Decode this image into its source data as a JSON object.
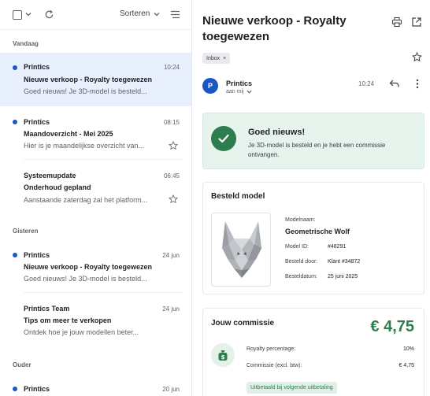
{
  "toolbar": {
    "sort_label": "Sorteren",
    "icons": [
      "select-all-checkbox",
      "chevron-down-icon",
      "refresh-icon",
      "filter-lines-icon"
    ]
  },
  "groups": {
    "today": "Vandaag",
    "yesterday": "Gisteren",
    "older": "Ouder"
  },
  "mail_list": [
    {
      "sender": "Printics",
      "time": "10:24",
      "subject": "Nieuwe verkoop - Royalty toegewezen",
      "snippet": "Goed nieuws! Je 3D-model is besteld...",
      "unread": true,
      "selected": true,
      "star": false
    },
    {
      "sender": "Printics",
      "time": "08:15",
      "subject": "Maandoverzicht - Mei 2025",
      "snippet": "Hier is je maandelijkse overzicht van...",
      "unread": true,
      "selected": false,
      "star": true
    },
    {
      "sender": "Systeemupdate",
      "time": "06:45",
      "subject": "Onderhoud gepland",
      "snippet": "Aanstaande zaterdag zal het platform...",
      "unread": false,
      "selected": false,
      "star": true
    },
    {
      "sender": "Printics",
      "time": "24 jun",
      "subject": "Nieuwe verkoop - Royalty toegewezen",
      "snippet": "Goed nieuws! Je 3D-model is besteld...",
      "unread": true,
      "selected": false,
      "star": false
    },
    {
      "sender": "Printics Team",
      "time": "24 jun",
      "subject": "Tips om meer te verkopen",
      "snippet": "Ontdek hoe je jouw modellen beter...",
      "unread": false,
      "selected": false,
      "star": false
    },
    {
      "sender": "Printics",
      "time": "20 jun",
      "subject": "",
      "snippet": "",
      "unread": true,
      "selected": false,
      "star": false
    }
  ],
  "message": {
    "title": "Nieuwe verkoop - Royalty toegewezen",
    "label_chip": "Inbox",
    "chip_close": "×",
    "sender": "Printics",
    "sender_initial": "P",
    "recipient": "aan mij",
    "time": "10:24"
  },
  "success": {
    "title": "Goed nieuws!",
    "text": "Je 3D-model is besteld en je hebt een commissie ontvangen."
  },
  "model": {
    "card_title": "Besteld model",
    "name_label": "Modelnaam:",
    "name": "Geometrische Wolf",
    "id_label": "Model ID:",
    "id": "#48291",
    "ordered_by_label": "Besteld door:",
    "ordered_by": "Klant #34872",
    "date_label": "Besteldatum:",
    "date": "25 juni 2025"
  },
  "commission": {
    "title": "Jouw commissie",
    "amount": "€ 4,75",
    "royalty_label": "Royalty percentage:",
    "royalty_value": "10%",
    "commission_label": "Commissie (excl. btw):",
    "commission_value": "€ 4,75",
    "badge": "Uitbetaald bij volgende uitbetaling"
  },
  "colors": {
    "accent_blue": "#1a56c4",
    "selected_bg": "#e8f0fe",
    "success_green": "#2e7d4f",
    "success_bg": "#e7f4ee"
  }
}
